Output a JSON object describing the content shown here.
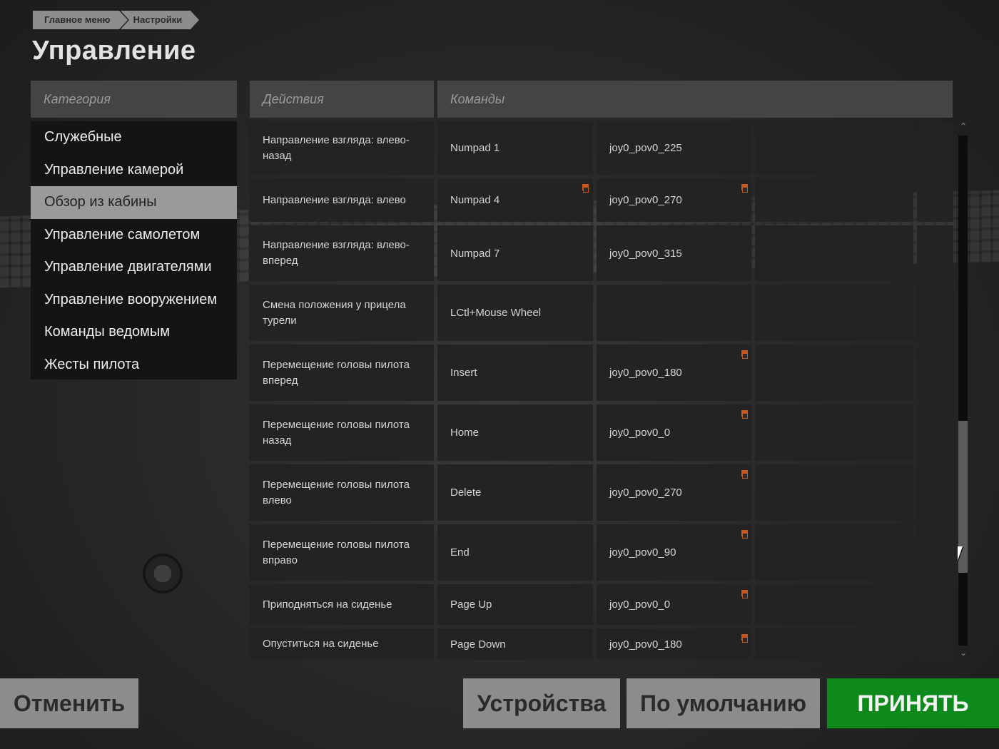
{
  "breadcrumb": [
    "Главное меню",
    "Настройки"
  ],
  "page_title": "Управление",
  "headers": {
    "category": "Категория",
    "actions": "Действия",
    "commands": "Команды"
  },
  "categories": [
    "Служебные",
    "Управление камерой",
    "Обзор из кабины",
    "Управление самолетом",
    "Управление двигателями",
    "Управление вооружением",
    "Команды ведомым",
    "Жесты пилота"
  ],
  "active_category": "Обзор из кабины",
  "bindings": [
    {
      "action": "Направление взгляда: влево-назад",
      "key1": "Numpad 1",
      "key2": "joy0_pov0_225",
      "marker1": false,
      "marker2": false
    },
    {
      "action": "Направление взгляда: влево",
      "key1": "Numpad 4",
      "key2": "joy0_pov0_270",
      "marker1": true,
      "marker2": true
    },
    {
      "action": "Направление взгляда: влево-вперед",
      "key1": "Numpad 7",
      "key2": "joy0_pov0_315",
      "marker1": false,
      "marker2": false
    },
    {
      "action": "Смена положения у прицела турели",
      "key1": "LCtl+Mouse Wheel",
      "key2": "",
      "marker1": false,
      "marker2": false
    },
    {
      "action": "Перемещение головы пилота вперед",
      "key1": "Insert",
      "key2": "joy0_pov0_180",
      "marker1": false,
      "marker2": true
    },
    {
      "action": "Перемещение головы пилота назад",
      "key1": "Home",
      "key2": "joy0_pov0_0",
      "marker1": false,
      "marker2": true
    },
    {
      "action": "Перемещение головы пилота влево",
      "key1": "Delete",
      "key2": "joy0_pov0_270",
      "marker1": false,
      "marker2": true
    },
    {
      "action": "Перемещение головы пилота вправо",
      "key1": "End",
      "key2": "joy0_pov0_90",
      "marker1": false,
      "marker2": true
    },
    {
      "action": "Приподняться на сиденье",
      "key1": "Page Up",
      "key2": "joy0_pov0_0",
      "marker1": false,
      "marker2": true
    },
    {
      "action": "Опуститься на сиденье",
      "key1": "Page Down",
      "key2": "joy0_pov0_180",
      "marker1": false,
      "marker2": true
    }
  ],
  "buttons": {
    "cancel": "Отменить",
    "devices": "Устройства",
    "default": "По умолчанию",
    "accept": "ПРИНЯТЬ"
  },
  "icons": {
    "scroll_up": "chevron-up-icon",
    "scroll_down": "chevron-down-icon",
    "binding_marker": "conflict-marker-icon"
  },
  "colors": {
    "accent_accept": "#0e8a1c",
    "marker": "#c9561b",
    "active_category": "#9a9a9a"
  }
}
